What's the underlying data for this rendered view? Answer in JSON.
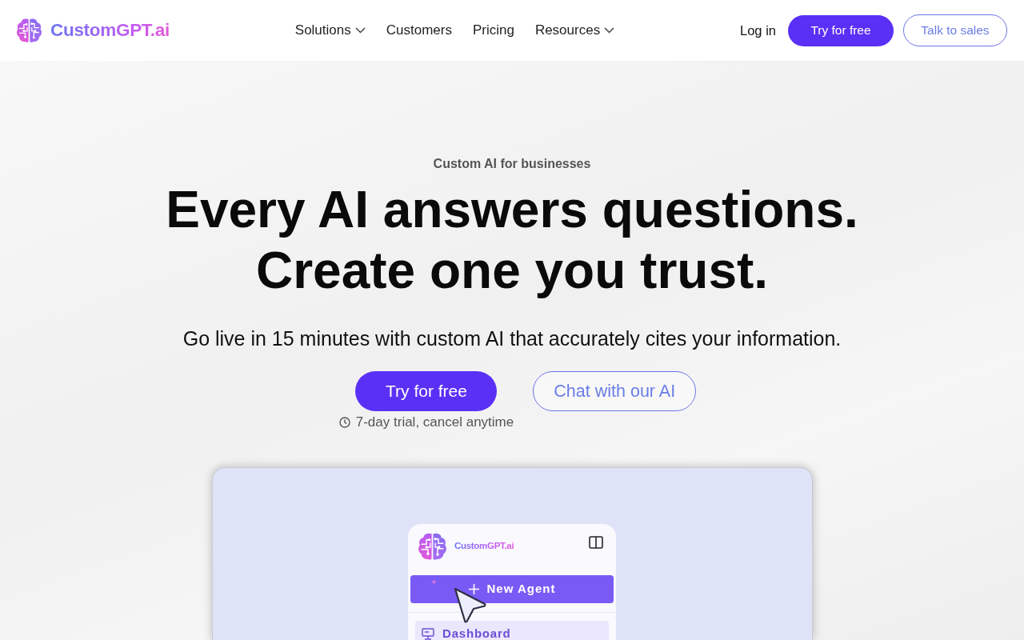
{
  "nav": {
    "logo_text": "CustomGPT.ai",
    "links": [
      {
        "label": "Solutions",
        "dropdown": true
      },
      {
        "label": "Customers",
        "dropdown": false
      },
      {
        "label": "Pricing",
        "dropdown": false
      },
      {
        "label": "Resources",
        "dropdown": true
      }
    ],
    "actions": [
      {
        "label": "Log in",
        "kind": "link"
      },
      {
        "label": "Try for free",
        "kind": "primary"
      },
      {
        "label": "Talk to sales",
        "kind": "outline"
      }
    ]
  },
  "hero": {
    "eyebrow": "Custom AI for businesses",
    "headline": [
      "Every AI answers questions.",
      "Create one you trust."
    ],
    "subtitle": "Go live in 15 minutes with custom AI that accurately cites your information.",
    "buttons": [
      {
        "label": "Try for free",
        "kind": "primary"
      },
      {
        "label": "Chat with our AI",
        "kind": "outline"
      }
    ],
    "note": "7-day trial, cancel anytime"
  },
  "preview": {
    "logo_text": "CustomGPT.ai",
    "new_agent_button": "New Agent",
    "menu": [
      {
        "label": "Dashboard",
        "selected": true
      }
    ]
  }
}
